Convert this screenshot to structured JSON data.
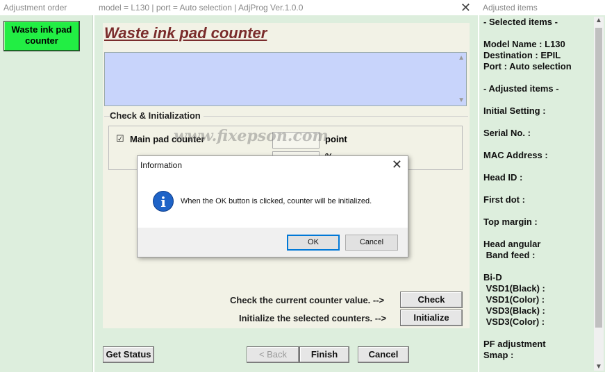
{
  "left_panel": {
    "title": "Adjustment order",
    "active_item": "Waste ink pad counter"
  },
  "main_window": {
    "title": "model = L130 | port = Auto selection | AdjProg Ver.1.0.0",
    "heading": "Waste ink pad counter",
    "group_label": "Check & Initialization",
    "main_pad_checked": true,
    "main_pad_label": "Main pad counter",
    "point_label": "point",
    "percent_label": "%",
    "watermark": "www.fixepson.com",
    "check_text": "Check the current counter value. -->",
    "check_button": "Check",
    "init_text": "Initialize the selected counters. -->",
    "initialize_button": "Initialize",
    "get_status_button": "Get Status",
    "back_button": "< Back",
    "finish_button": "Finish",
    "cancel_button": "Cancel"
  },
  "right_panel": {
    "title": "Adjusted items",
    "lines": [
      "- Selected items -",
      "",
      "Model Name : L130",
      "Destination : EPIL",
      "Port : Auto selection",
      "",
      "- Adjusted items -",
      "",
      "Initial Setting :",
      "",
      "Serial No. :",
      "",
      "MAC Address :",
      "",
      "Head ID :",
      "",
      "First dot :",
      "",
      "Top margin :",
      "",
      "Head angular",
      " Band feed :",
      "",
      "Bi-D",
      " VSD1(Black) :",
      " VSD1(Color) :",
      " VSD3(Black) :",
      " VSD3(Color) :",
      "",
      "PF adjustment",
      "Smap :"
    ]
  },
  "dialog": {
    "title": "Information",
    "icon": "info-icon",
    "message": "When the OK button is clicked, counter will be initialized.",
    "ok_button": "OK",
    "cancel_button": "Cancel"
  }
}
